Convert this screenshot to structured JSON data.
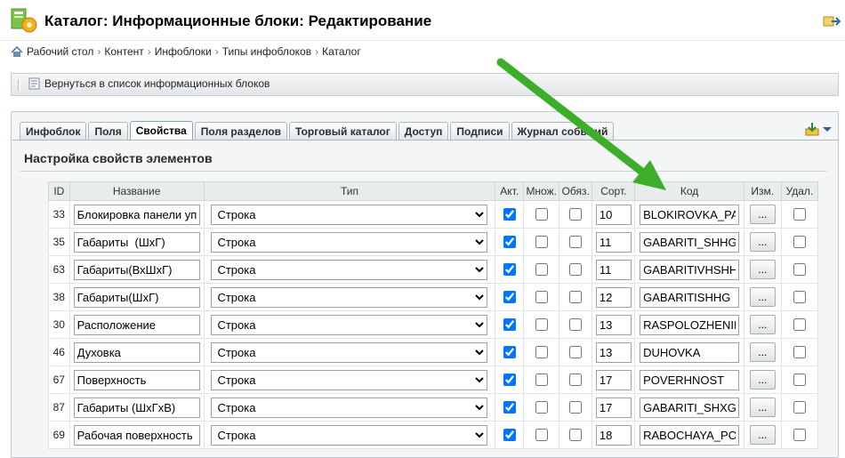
{
  "header": {
    "title": "Каталог: Информационные блоки: Редактирование"
  },
  "breadcrumb": [
    "Рабочий стол",
    "Контент",
    "Инфоблоки",
    "Типы инфоблоков",
    "Каталог"
  ],
  "toolbar": {
    "back_label": "Вернуться в список информационных блоков"
  },
  "tabs": [
    {
      "label": "Инфоблок",
      "active": false
    },
    {
      "label": "Поля",
      "active": false
    },
    {
      "label": "Свойства",
      "active": true
    },
    {
      "label": "Поля разделов",
      "active": false
    },
    {
      "label": "Торговый каталог",
      "active": false
    },
    {
      "label": "Доступ",
      "active": false
    },
    {
      "label": "Подписи",
      "active": false
    },
    {
      "label": "Журнал событий",
      "active": false
    }
  ],
  "section": {
    "title": "Настройка свойств элементов"
  },
  "table": {
    "columns": [
      "ID",
      "Название",
      "Тип",
      "Акт.",
      "Множ.",
      "Обяз.",
      "Сорт.",
      "Код",
      "Изм.",
      "Удал."
    ],
    "rows": [
      {
        "id": "33",
        "name": "Блокировка панели управления",
        "type": "Строка",
        "active": true,
        "multiple": false,
        "required": false,
        "sort": "10",
        "code": "BLOKIROVKA_PANELI",
        "edit": "...",
        "delete": false
      },
      {
        "id": "35",
        "name": "Габариты  (ШхГ)",
        "type": "Строка",
        "active": true,
        "multiple": false,
        "required": false,
        "sort": "11",
        "code": "GABARITI_SHHG",
        "edit": "...",
        "delete": false
      },
      {
        "id": "63",
        "name": "Габариты(ВхШхГ)",
        "type": "Строка",
        "active": true,
        "multiple": false,
        "required": false,
        "sort": "11",
        "code": "GABARITIVHSHHG",
        "edit": "...",
        "delete": false
      },
      {
        "id": "38",
        "name": "Габариты(ШхГ)",
        "type": "Строка",
        "active": true,
        "multiple": false,
        "required": false,
        "sort": "12",
        "code": "GABARITISHHG",
        "edit": "...",
        "delete": false
      },
      {
        "id": "30",
        "name": "Расположение",
        "type": "Строка",
        "active": true,
        "multiple": false,
        "required": false,
        "sort": "13",
        "code": "RASPOLOZHENIE",
        "edit": "...",
        "delete": false
      },
      {
        "id": "46",
        "name": "Духовка",
        "type": "Строка",
        "active": true,
        "multiple": false,
        "required": false,
        "sort": "13",
        "code": "DUHOVKA",
        "edit": "...",
        "delete": false
      },
      {
        "id": "67",
        "name": "Поверхность",
        "type": "Строка",
        "active": true,
        "multiple": false,
        "required": false,
        "sort": "17",
        "code": "POVERHNOST",
        "edit": "...",
        "delete": false
      },
      {
        "id": "87",
        "name": "Габариты (ШхГхВ)",
        "type": "Строка",
        "active": true,
        "multiple": false,
        "required": false,
        "sort": "17",
        "code": "GABARITI_SHXGXV",
        "edit": "...",
        "delete": false
      },
      {
        "id": "69",
        "name": "Рабочая поверхность",
        "type": "Строка",
        "active": true,
        "multiple": false,
        "required": false,
        "sort": "18",
        "code": "RABOCHAYA_POVERHNOST",
        "edit": "...",
        "delete": false
      }
    ]
  },
  "colors": {
    "accent_arrow": "#3cae2a",
    "tab_border": "#a9b6ba",
    "panel_bg": "#f3f5f6"
  },
  "icons": [
    "app-icon",
    "home-icon",
    "back-list-icon",
    "download-icon",
    "chevron-down-icon",
    "exit-icon"
  ]
}
